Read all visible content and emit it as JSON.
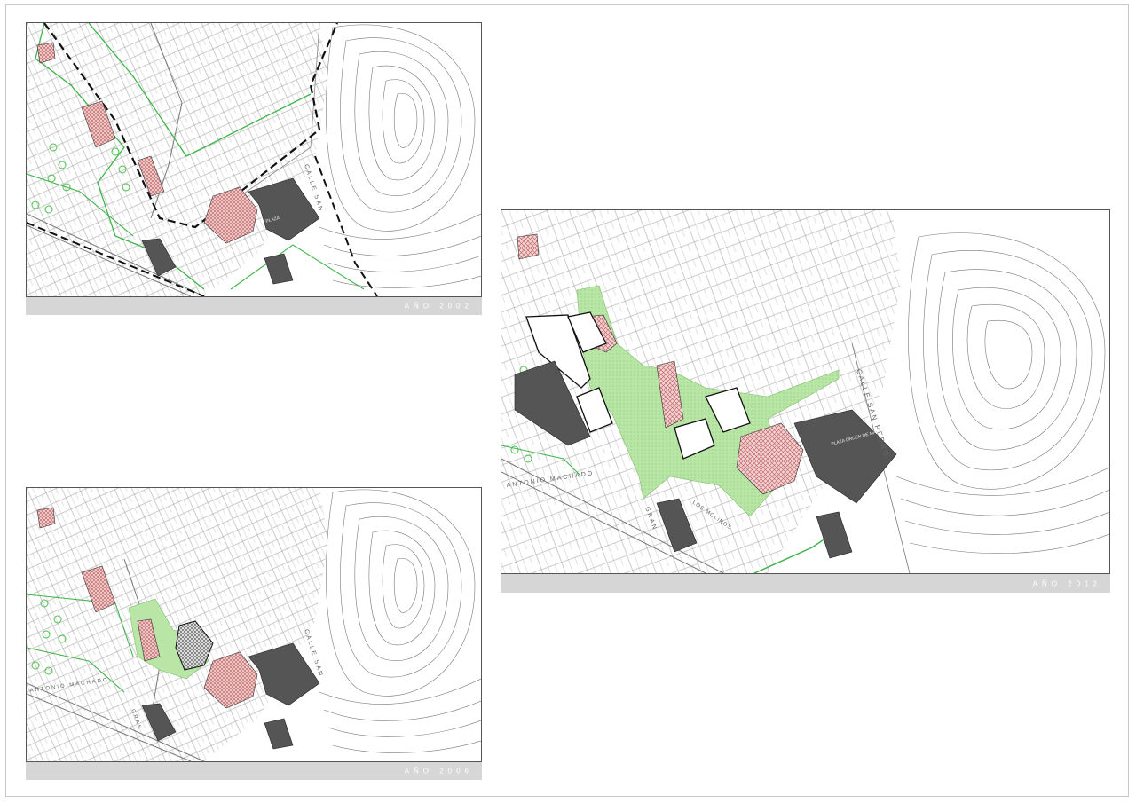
{
  "panels": {
    "p2002": {
      "caption": "AÑO 2002"
    },
    "p2006": {
      "caption": "AÑO 2006"
    },
    "p2012": {
      "caption": "AÑO 2012"
    }
  },
  "labels": {
    "calle_san": "CALLE SAN",
    "calle_san_pedro": "CALLE SAN PEDRO",
    "antonio_machado": "ANTONIO MACHADO",
    "gran": "GRAN",
    "los_molinos": "LOS MOLINOS",
    "plaza": "PLAZA",
    "plaza_name": "PLAZA ORDEN DE MALTA"
  },
  "colors": {
    "green_zone": "#b9e6a6",
    "green_line": "#3fb54a",
    "hatch_red": "#c56a6a",
    "dark_building": "#555555",
    "caption_bar": "#d6d6d6"
  }
}
